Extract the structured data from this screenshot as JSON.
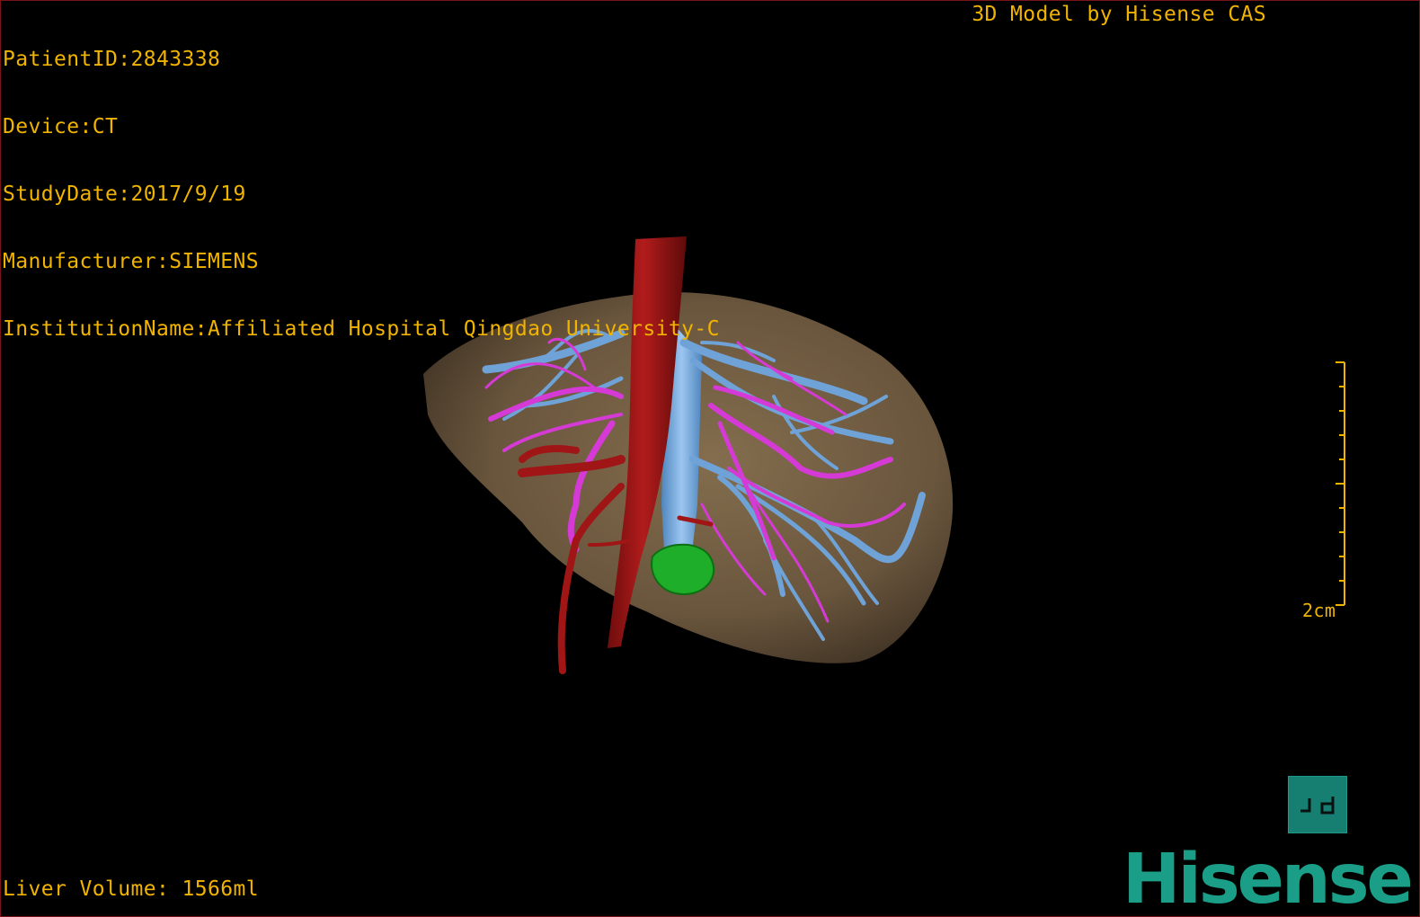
{
  "viewer": {
    "patient_line": "PatientID:2843338",
    "device_line": "Device:CT",
    "study_line": "StudyDate:2017/9/19",
    "manufacturer_line": "Manufacturer:SIEMENS",
    "institution_line": "InstitutionName:Affiliated Hospital Qingdao University-C",
    "header_right": "3D Model by Hisense CAS",
    "liver_volume": "Liver Volume: 1566ml",
    "scale_label": "2cm",
    "pd_button_label": "ㄴd",
    "brand": "Hisense"
  },
  "colors": {
    "overlay_text": "#f0b400",
    "liver": "#7a6548",
    "aorta": "#a01515",
    "portal_vein": "#6fa3d8",
    "hepatic_artery_branches": "#d63ad6",
    "gallbladder": "#1fae2a",
    "brand": "#1a9e88"
  },
  "icons": {
    "pd_button": "pd-toggle-icon",
    "brand": "hisense-logo"
  }
}
